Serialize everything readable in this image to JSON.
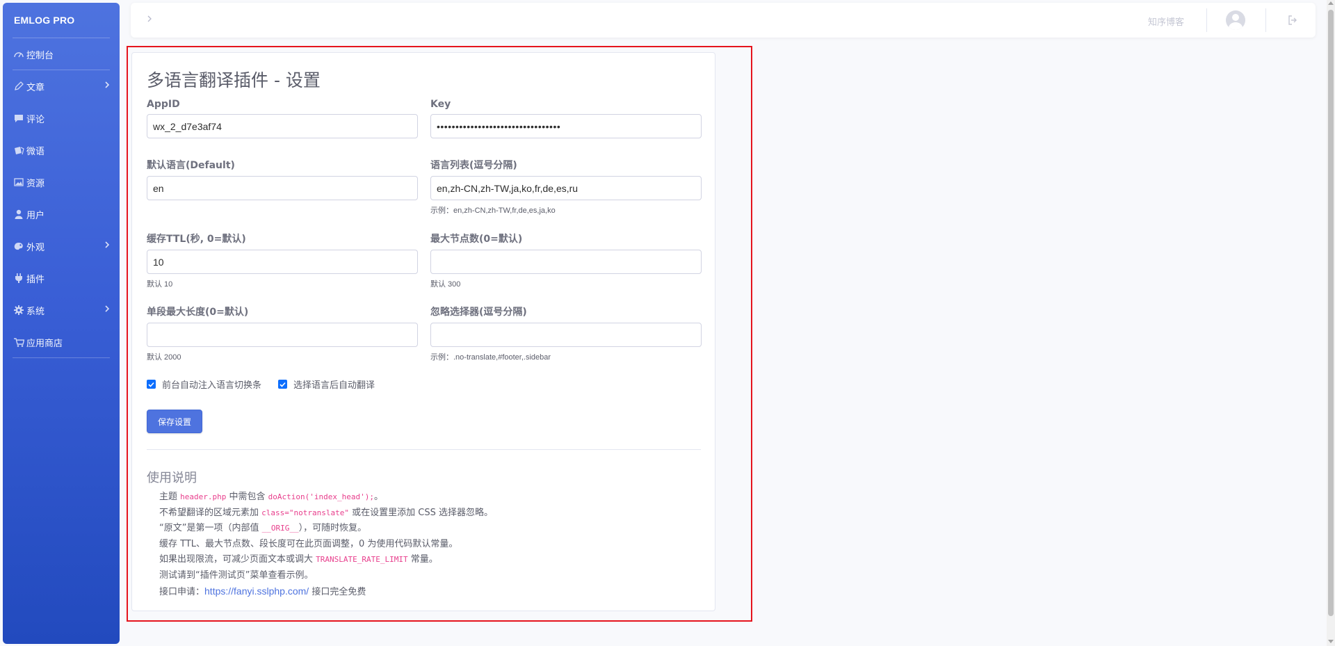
{
  "sidebar": {
    "brand": "EMLOG PRO",
    "items": [
      {
        "label": "控制台",
        "icon": "dashboard-icon"
      },
      {
        "label": "文章",
        "icon": "pen-icon",
        "has_submenu": true
      },
      {
        "label": "评论",
        "icon": "comment-icon"
      },
      {
        "label": "微语",
        "icon": "note-icon"
      },
      {
        "label": "资源",
        "icon": "image-icon"
      },
      {
        "label": "用户",
        "icon": "user-icon"
      },
      {
        "label": "外观",
        "icon": "palette-icon",
        "has_submenu": true
      },
      {
        "label": "插件",
        "icon": "plug-icon"
      },
      {
        "label": "系统",
        "icon": "gear-icon",
        "has_submenu": true
      },
      {
        "label": "应用商店",
        "icon": "cart-icon"
      }
    ]
  },
  "topbar": {
    "site_name": "知序博客"
  },
  "settings": {
    "title": "多语言翻译插件 - 设置",
    "appid": {
      "label": "AppID",
      "value": "wx_2_d7e3af74"
    },
    "key": {
      "label": "Key",
      "value": "•••••••••••••••••••••••••••••••••"
    },
    "default_lang": {
      "label": "默认语言(Default)",
      "value": "en"
    },
    "lang_list": {
      "label": "语言列表(逗号分隔)",
      "value": "en,zh-CN,zh-TW,ja,ko,fr,de,es,ru",
      "help": "示例：en,zh-CN,zh-TW,fr,de,es,ja,ko"
    },
    "cache_ttl": {
      "label": "缓存TTL(秒, 0=默认)",
      "value": "10",
      "help": "默认 10"
    },
    "max_nodes": {
      "label": "最大节点数(0=默认)",
      "value": "",
      "help": "默认 300"
    },
    "max_len": {
      "label": "单段最大长度(0=默认)",
      "value": "",
      "help": "默认 2000"
    },
    "ignore_selectors": {
      "label": "忽略选择器(逗号分隔)",
      "value": "",
      "help": "示例：.no-translate,#footer,.sidebar"
    },
    "check_inject": {
      "label": "前台自动注入语言切换条",
      "checked": true
    },
    "check_auto": {
      "label": "选择语言后自动翻译",
      "checked": true
    },
    "save_label": "保存设置"
  },
  "usage": {
    "title": "使用说明",
    "l1a": "主题 ",
    "l1_code1": "header.php",
    "l1b": " 中需包含 ",
    "l1_code2": "doAction('index_head');",
    "l1c": "。",
    "l2a": "不希望翻译的区域元素加 ",
    "l2_code": "class=\"notranslate\"",
    "l2b": " 或在设置里添加 CSS 选择器忽略。",
    "l3a": "“原文”是第一项（内部值 ",
    "l3_code": "__ORIG__",
    "l3b": "），可随时恢复。",
    "l4": "缓存 TTL、最大节点数、段长度可在此页面调整，0 为使用代码默认常量。",
    "l5a": "如果出现限流，可减少页面文本或调大 ",
    "l5_code": "TRANSLATE_RATE_LIMIT",
    "l5b": " 常量。",
    "l6": "测试请到“插件测试页”菜单查看示例。",
    "l7a": "接口申请：",
    "l7_link": "https://fanyi.sslphp.com/",
    "l7b": " 接口完全免费"
  },
  "colors": {
    "accent": "#4e73df",
    "highlight": "#e5141d",
    "checkbox": "#0d6efd"
  }
}
